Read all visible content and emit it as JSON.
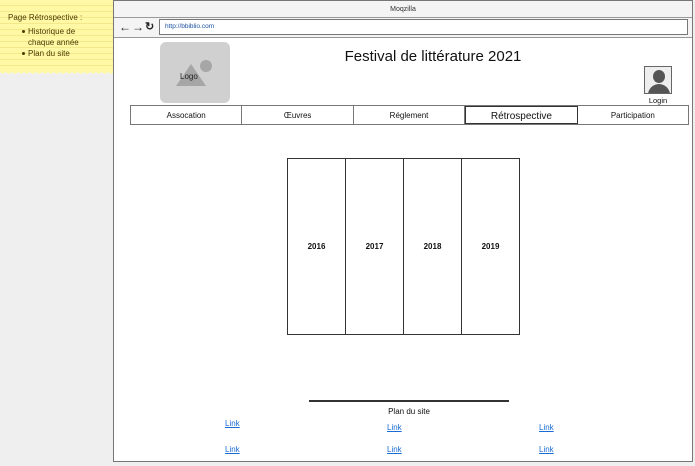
{
  "note": {
    "title": "Page Rétrospective :",
    "items": [
      "Historique de chaque année",
      "Plan du site"
    ]
  },
  "browser": {
    "window_title": "Moqzilla",
    "url": "http://bbiblio.com",
    "icons": [
      "back-arrow-icon",
      "forward-arrow-icon",
      "refresh-icon"
    ]
  },
  "header": {
    "logo_label": "Logo",
    "site_title": "Festival de littérature 2021",
    "login_label": "Login"
  },
  "menu": {
    "items": [
      {
        "label": "Assocation"
      },
      {
        "label": "Œuvres"
      },
      {
        "label": "Réglement"
      },
      {
        "label": "Rétrospective",
        "active": true
      },
      {
        "label": "Participation"
      }
    ]
  },
  "years": [
    "2016",
    "2017",
    "2018",
    "2019"
  ],
  "sitemap": {
    "title": "Plan du site",
    "links": [
      "Link",
      "Link",
      "Link",
      "Link",
      "Link",
      "Link"
    ]
  }
}
